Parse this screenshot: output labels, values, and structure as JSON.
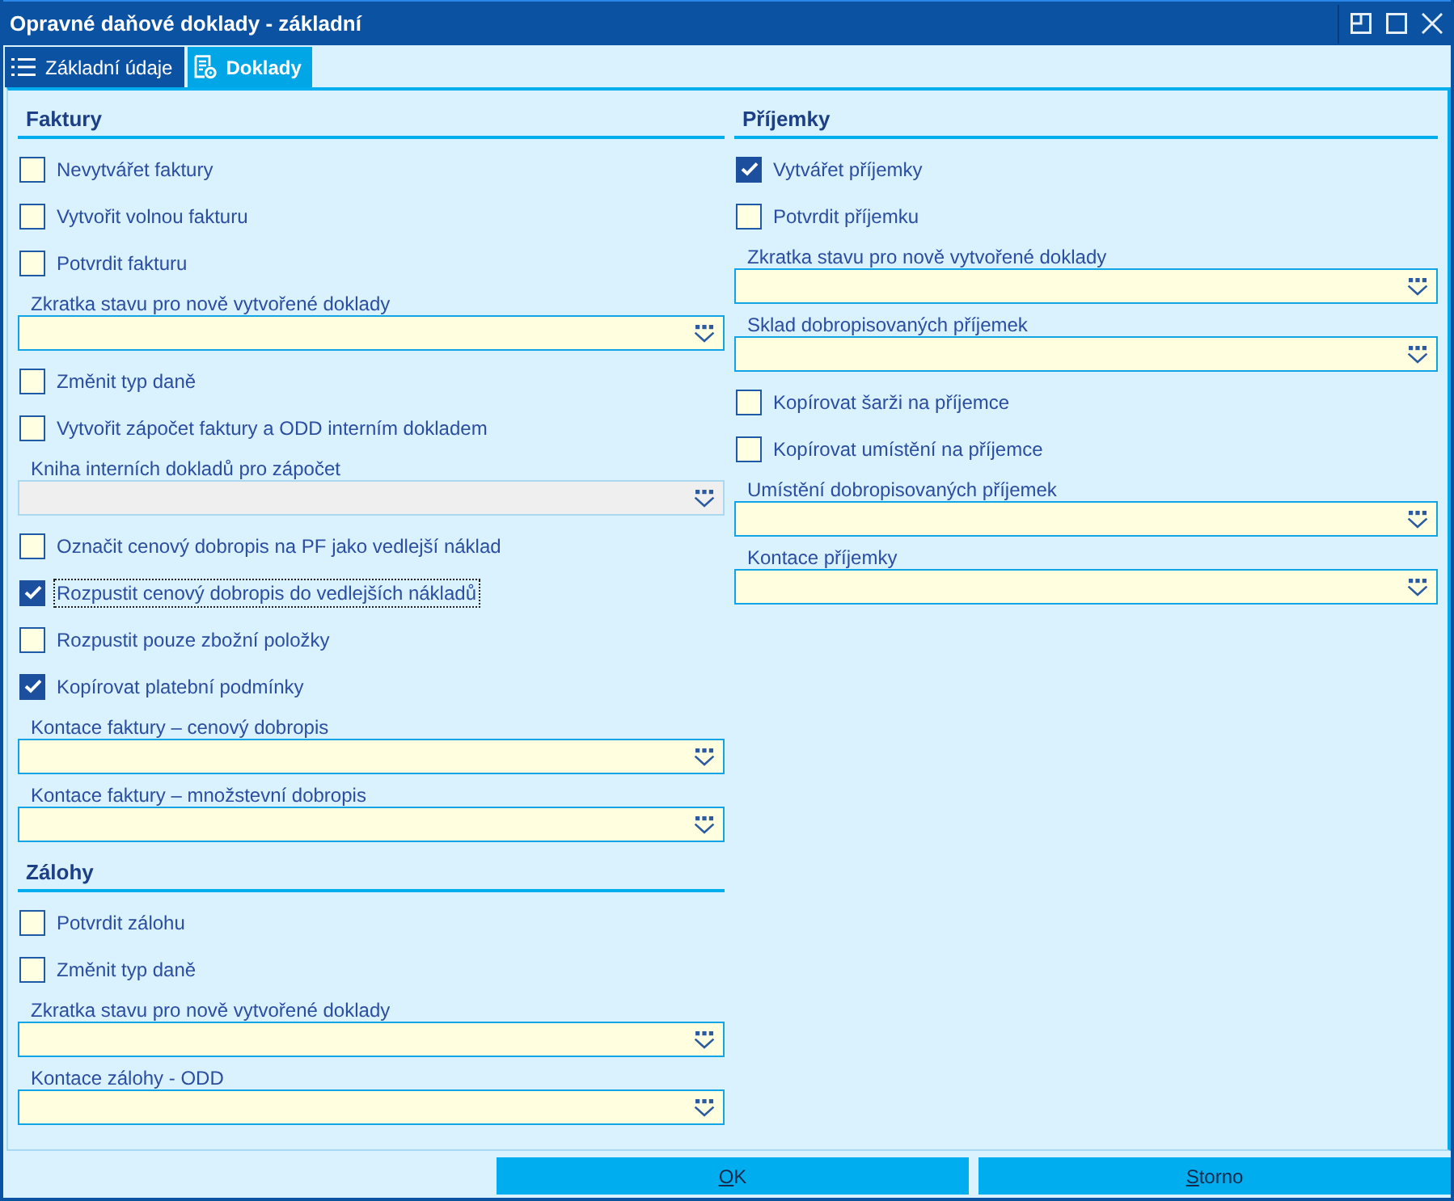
{
  "window": {
    "title": "Opravné daňové doklady - základní"
  },
  "tabs": [
    {
      "label": "Základní údaje",
      "selected": false
    },
    {
      "label": "Doklady",
      "selected": true
    }
  ],
  "columns": [
    {
      "sections": [
        {
          "title": "Faktury",
          "items": [
            {
              "kind": "checkbox",
              "label": "Nevytvářet faktury",
              "checked": false,
              "focused": false
            },
            {
              "kind": "checkbox",
              "label": "Vytvořit volnou fakturu",
              "checked": false,
              "focused": false
            },
            {
              "kind": "checkbox",
              "label": "Potvrdit fakturu",
              "checked": false,
              "focused": false
            },
            {
              "kind": "dropdown",
              "label": "Zkratka stavu pro nově vytvořené doklady",
              "disabled": false
            },
            {
              "kind": "checkbox",
              "label": "Změnit typ daně",
              "checked": false,
              "focused": false
            },
            {
              "kind": "checkbox",
              "label": "Vytvořit zápočet faktury a ODD interním dokladem",
              "checked": false,
              "focused": false
            },
            {
              "kind": "dropdown",
              "label": "Kniha interních dokladů pro zápočet",
              "disabled": true
            },
            {
              "kind": "checkbox",
              "label": "Označit cenový dobropis na PF jako vedlejší náklad",
              "checked": false,
              "focused": false
            },
            {
              "kind": "checkbox",
              "label": "Rozpustit cenový dobropis do vedlejších nákladů",
              "checked": true,
              "focused": true
            },
            {
              "kind": "checkbox",
              "label": "Rozpustit pouze zbožní položky",
              "checked": false,
              "focused": false
            },
            {
              "kind": "checkbox",
              "label": "Kopírovat platební podmínky",
              "checked": true,
              "focused": false
            },
            {
              "kind": "dropdown",
              "label": "Kontace faktury – cenový dobropis",
              "disabled": false
            },
            {
              "kind": "dropdown",
              "label": "Kontace faktury – množstevní dobropis",
              "disabled": false
            }
          ]
        },
        {
          "title": "Zálohy",
          "items": [
            {
              "kind": "checkbox",
              "label": "Potvrdit zálohu",
              "checked": false,
              "focused": false
            },
            {
              "kind": "checkbox",
              "label": "Změnit typ daně",
              "checked": false,
              "focused": false
            },
            {
              "kind": "dropdown",
              "label": "Zkratka stavu pro nově vytvořené doklady",
              "disabled": false
            },
            {
              "kind": "dropdown",
              "label": "Kontace zálohy - ODD",
              "disabled": false
            }
          ]
        }
      ]
    },
    {
      "sections": [
        {
          "title": "Příjemky",
          "items": [
            {
              "kind": "checkbox",
              "label": "Vytvářet příjemky",
              "checked": true,
              "focused": false
            },
            {
              "kind": "checkbox",
              "label": "Potvrdit příjemku",
              "checked": false,
              "focused": false
            },
            {
              "kind": "dropdown",
              "label": "Zkratka stavu pro nově vytvořené doklady",
              "disabled": false
            },
            {
              "kind": "dropdown",
              "label": "Sklad dobropisovaných příjemek",
              "disabled": false
            },
            {
              "kind": "checkbox",
              "label": "Kopírovat šarži na příjemce",
              "checked": false,
              "focused": false
            },
            {
              "kind": "checkbox",
              "label": "Kopírovat umístění na příjemce",
              "checked": false,
              "focused": false
            },
            {
              "kind": "dropdown",
              "label": "Umístění dobropisovaných příjemek",
              "disabled": false
            },
            {
              "kind": "dropdown",
              "label": "Kontace příjemky",
              "disabled": false
            }
          ]
        }
      ]
    }
  ],
  "buttons": [
    {
      "label": "OK"
    },
    {
      "label": "Storno"
    }
  ]
}
